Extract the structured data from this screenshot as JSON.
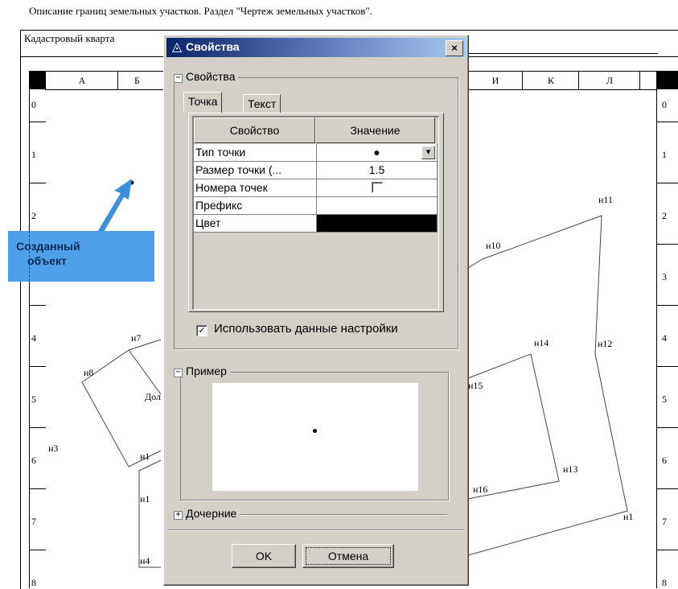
{
  "document": {
    "title": "Описание границ земельных участков. Раздел \"Чертеж земельных участков\".",
    "kvartal_label": "Кадастровый кварта",
    "columns": [
      "А",
      "Б",
      "И",
      "К",
      "Л"
    ],
    "rows": [
      "0",
      "1",
      "2",
      "3",
      "4",
      "5",
      "6",
      "7",
      "8"
    ],
    "point_labels": [
      "н11",
      "н10",
      "н14",
      "н12",
      "н15",
      "н13",
      "н16",
      "н1",
      "н7",
      "н8",
      "н3",
      "н1",
      "н1",
      "н4"
    ],
    "partial_text": "Дол"
  },
  "callout": {
    "line1": "Созданный",
    "line2": "объект"
  },
  "dialog": {
    "title": "Свойства",
    "close_label": "×",
    "properties_group": "Свойства",
    "tabs": [
      {
        "label": "Точка",
        "active": true
      },
      {
        "label": "Текст",
        "active": false
      }
    ],
    "table": {
      "headers": [
        "Свойство",
        "Значение"
      ],
      "rows": [
        {
          "name": "Тип точки",
          "value": "●"
        },
        {
          "name": "Размер точки (...",
          "value": "1.5"
        },
        {
          "name": "Номера точек",
          "value": ""
        },
        {
          "name": "Префикс",
          "value": ""
        },
        {
          "name": "Цвет",
          "value": ""
        }
      ],
      "color_value": "#000000"
    },
    "use_settings_label": "Использовать данные настройки",
    "use_settings_checked": "✓",
    "example_group": "Пример",
    "child_group": "Дочерние",
    "ok_label": "OK",
    "cancel_label": "Отмена"
  },
  "icons": {
    "dropdown": "▾",
    "expander_minus": "−",
    "expander_plus": "+"
  }
}
